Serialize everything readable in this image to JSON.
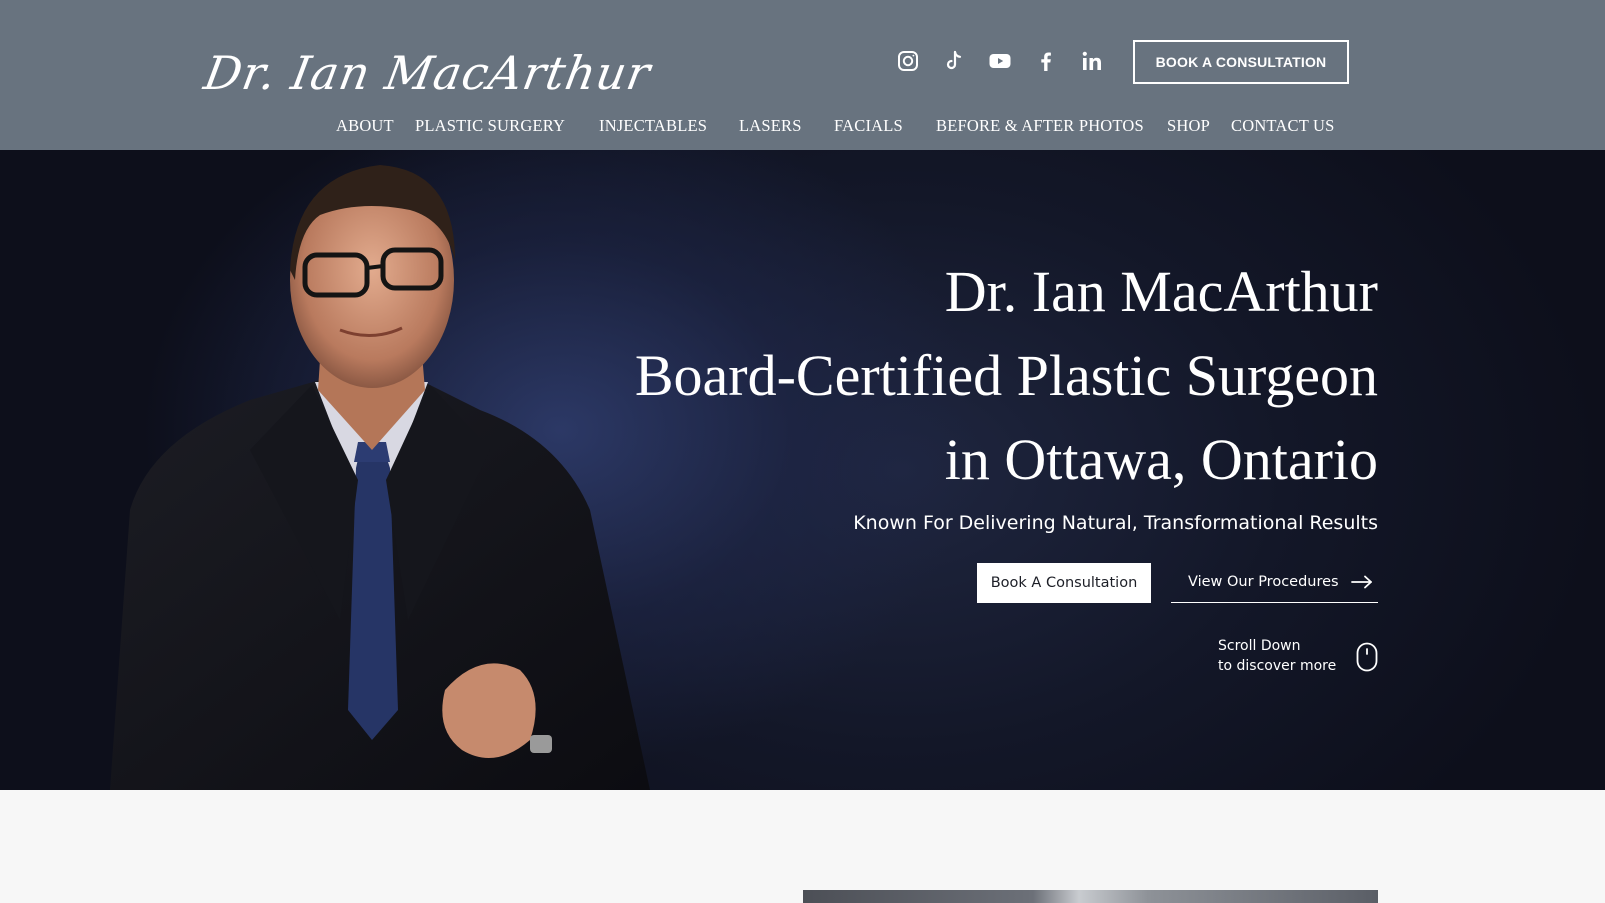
{
  "header": {
    "logo_text": "Dr. Ian MacArthur",
    "book_button": "BOOK A CONSULTATION",
    "socials": [
      "instagram-icon",
      "tiktok-icon",
      "youtube-icon",
      "facebook-icon",
      "linkedin-icon"
    ],
    "nav": [
      "ABOUT",
      "PLASTIC SURGERY",
      "INJECTABLES",
      "LASERS",
      "FACIALS",
      "BEFORE & AFTER PHOTOS",
      "SHOP",
      "CONTACT US"
    ]
  },
  "hero": {
    "title_lines": [
      "Dr. Ian MacArthur",
      "Board-Certified Plastic Surgeon",
      "in Ottawa, Ontario"
    ],
    "subtitle": "Known For Delivering Natural, Transformational Results",
    "cta_primary": "Book A Consultation",
    "cta_secondary": "View Our Procedures",
    "scroll_line1": "Scroll Down",
    "scroll_line2": "to discover more"
  },
  "colors": {
    "header_bg": "#68737f",
    "hero_bg": "#131728",
    "text": "#ffffff",
    "page_bg": "#f7f7f7"
  }
}
